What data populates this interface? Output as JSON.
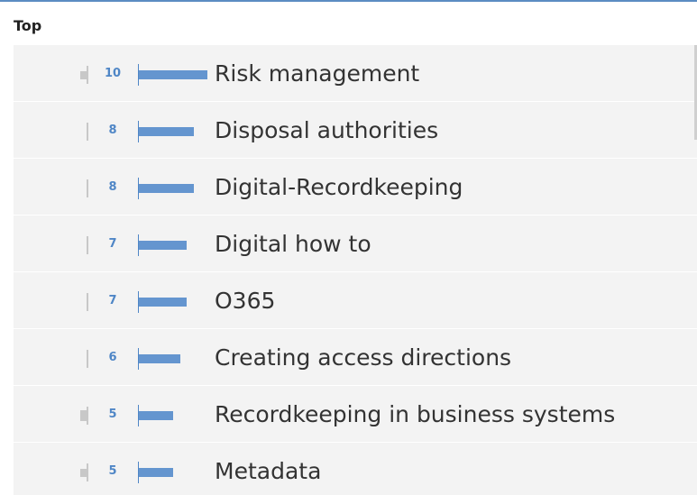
{
  "header": {
    "title": "Top"
  },
  "chart_data": {
    "type": "bar",
    "orientation": "horizontal",
    "categories": [
      "Risk management",
      "Disposal authorities",
      "Digital-Recordkeeping",
      "Digital how to",
      "O365",
      "Creating access directions",
      "Recordkeeping in business systems",
      "Metadata"
    ],
    "values": [
      10,
      8,
      8,
      7,
      7,
      6,
      5,
      5
    ],
    "trend_values": [
      2,
      0,
      0,
      0,
      0,
      0,
      3,
      2
    ],
    "title": "Top",
    "xlabel": "",
    "ylabel": "",
    "colors": {
      "bar": "#6495cf",
      "count": "#4f86c6",
      "trend": "#c8c8c8",
      "row_bg": "#f3f3f3"
    }
  }
}
